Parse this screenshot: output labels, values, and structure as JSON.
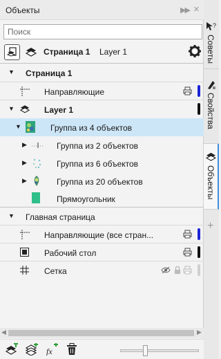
{
  "panel": {
    "title": "Объекты",
    "search": {
      "placeholder": "Поиск",
      "value": ""
    }
  },
  "page_toolbar": {
    "page_name": "Страница 1",
    "layer_name": "Layer 1"
  },
  "tree": {
    "page1": {
      "label": "Страница 1",
      "guides": "Направляющие",
      "layer": "Layer 1",
      "group4": "Группа из 4 объектов",
      "group2": "Группа из 2 объектов",
      "group6": "Группа из 6 объектов",
      "group20": "Группа из 20 объектов",
      "rect": "Прямоугольник"
    },
    "master": {
      "label": "Главная страница",
      "guides_all": "Направляющие (все стран...",
      "desktop": "Рабочий стол",
      "grid": "Сетка"
    }
  },
  "dock_tabs": [
    "Советы",
    "Свойства",
    "Объекты"
  ],
  "colors": {
    "selection": "#cde6f7",
    "layer_blue": "#1b24d6",
    "layer_black": "#111111",
    "rect_fill": "#2fbf8a",
    "active_tab_accent": "#3d8ee0"
  },
  "icons": {
    "title": [
      "double-arrow-right-icon",
      "close-icon"
    ],
    "toolbar": [
      "page-view-icon",
      "layers-icon",
      "gear-icon"
    ],
    "bottom": [
      "new-layer-icon",
      "new-master-layer-icon",
      "effects-icon",
      "trash-icon"
    ]
  }
}
